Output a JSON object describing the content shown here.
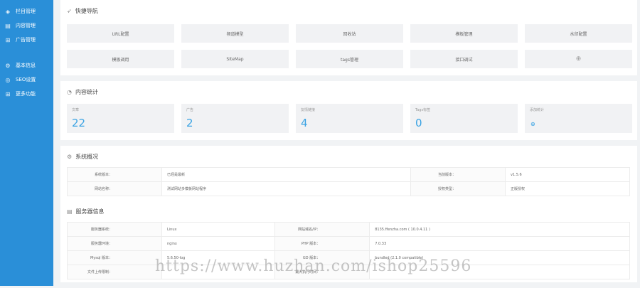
{
  "sidebar": {
    "items": [
      {
        "icon": "layers-icon",
        "label": "栏目管理"
      },
      {
        "icon": "document-icon",
        "label": "内容管理"
      },
      {
        "icon": "ad-icon",
        "label": "广告管理"
      }
    ],
    "items2": [
      {
        "icon": "settings-icon",
        "label": "基本信息"
      },
      {
        "icon": "compass-icon",
        "label": "SEO设置"
      },
      {
        "icon": "grid-icon",
        "label": "更多功能"
      }
    ]
  },
  "quicknav": {
    "title": "快捷导航",
    "buttons": [
      "URL配置",
      "频道模型",
      "回收站",
      "模板管理",
      "水印配置",
      "模板调用",
      "SiteMap",
      "tags管理",
      "接口调试",
      "⊕"
    ]
  },
  "stats": {
    "title": "内容统计",
    "items": [
      {
        "label": "文章",
        "value": "22"
      },
      {
        "label": "广告",
        "value": "2"
      },
      {
        "label": "友情链接",
        "value": "4"
      },
      {
        "label": "Tags标签",
        "value": "0"
      },
      {
        "label": "添加统计",
        "value": "⊕"
      }
    ]
  },
  "sysinfo": {
    "title": "系统概况",
    "rows": [
      {
        "k1": "系统版本：",
        "v1": "已经是最新",
        "k2": "当前版本：",
        "v2": "v1.5.6"
      },
      {
        "k1": "网站名称：",
        "v1": "测试网站多模板网站程序",
        "k2": "授权类型：",
        "v2": "正版授权"
      }
    ]
  },
  "server": {
    "title": "服务器信息",
    "rows": [
      {
        "k1": "服务器系统：",
        "v1": "Linux",
        "k2": "网站域名/IP：",
        "v2": "8135.ffenzha.com ( 10.0.4.11 )"
      },
      {
        "k1": "服务器环境：",
        "v1": "nginx",
        "k2": "PHP 版本：",
        "v2": "7.0.33"
      },
      {
        "k1": "Mysql 版本：",
        "v1": "5.6.50-log",
        "k2": "GD 版本：",
        "v2": "bundled (2.1.0 compatible)"
      },
      {
        "k1": "文件上传限制：",
        "v1": "",
        "k2": "最大执行时间：",
        "v2": ""
      }
    ]
  },
  "watermark": "https://www.huzhan.com/ishop25596"
}
